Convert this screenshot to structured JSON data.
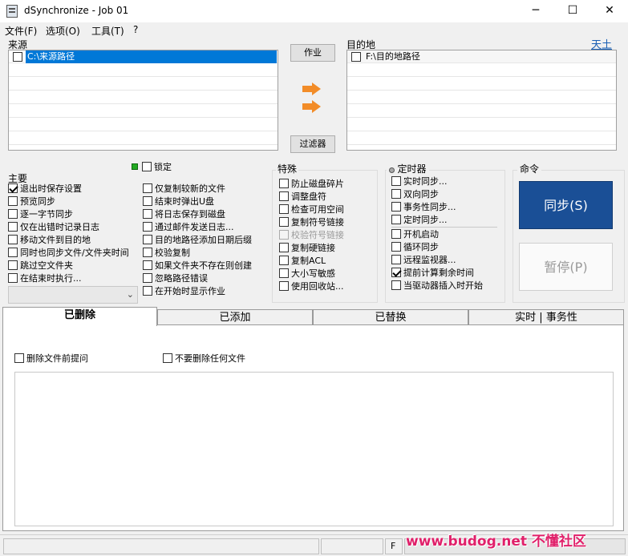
{
  "window": {
    "title": "dSynchronize - Job 01",
    "minimize": "─",
    "maximize": "☐",
    "close": "✕"
  },
  "menu": {
    "file": "文件(F)",
    "options": "选项(O)",
    "tools": "工具(T)",
    "help": "?"
  },
  "source": {
    "label": "来源",
    "path": "C:\\来源路径"
  },
  "dest": {
    "label": "目的地",
    "path": "F:\\目的地路径",
    "link": "天土"
  },
  "buttons": {
    "job": "作业",
    "filter": "过滤器"
  },
  "lock": {
    "label": "锁定"
  },
  "main": {
    "label": "主要",
    "col1": [
      {
        "label": "退出时保存设置",
        "checked": true
      },
      {
        "label": "预览同步",
        "checked": false
      },
      {
        "label": "逐一字节同步",
        "checked": false
      },
      {
        "label": "仅在出错时记录日志",
        "checked": false
      },
      {
        "label": "移动文件到目的地",
        "checked": false
      },
      {
        "label": "同时也同步文件/文件夹时间",
        "checked": false
      },
      {
        "label": "跳过空文件夹",
        "checked": false
      },
      {
        "label": "在结束时执行...",
        "checked": false
      }
    ],
    "col2": [
      {
        "label": "仅复制较新的文件",
        "checked": false
      },
      {
        "label": "结束时弹出U盘",
        "checked": false
      },
      {
        "label": "将日志保存到磁盘",
        "checked": false
      },
      {
        "label": "通过邮件发送日志...",
        "checked": false
      },
      {
        "label": "目的地路径添加日期后缀",
        "checked": false
      },
      {
        "label": "校验复制",
        "checked": false
      },
      {
        "label": "如果文件夹不存在则创建",
        "checked": false
      },
      {
        "label": "忽略路径错误",
        "checked": false
      },
      {
        "label": "在开始时显示作业",
        "checked": false
      }
    ]
  },
  "special": {
    "label": "特殊",
    "items": [
      {
        "label": "防止磁盘碎片",
        "checked": false,
        "disabled": false
      },
      {
        "label": "调整盘符",
        "checked": false,
        "disabled": false
      },
      {
        "label": "检查可用空间",
        "checked": false,
        "disabled": false
      },
      {
        "label": "复制符号链接",
        "checked": false,
        "disabled": false
      },
      {
        "label": "校验符号链接",
        "checked": false,
        "disabled": true
      },
      {
        "label": "复制硬链接",
        "checked": false,
        "disabled": false
      },
      {
        "label": "复制ACL",
        "checked": false,
        "disabled": false
      },
      {
        "label": "大小写敏感",
        "checked": false,
        "disabled": false
      },
      {
        "label": "使用回收站...",
        "checked": false,
        "disabled": false
      }
    ]
  },
  "timer": {
    "label": "定时器",
    "items_a": [
      {
        "label": "实时同步...",
        "checked": false
      },
      {
        "label": "双向同步",
        "checked": false
      },
      {
        "label": "事务性同步...",
        "checked": false
      },
      {
        "label": "定时同步...",
        "checked": false
      }
    ],
    "items_b": [
      {
        "label": "开机启动",
        "checked": false
      },
      {
        "label": "循环同步",
        "checked": false
      },
      {
        "label": "远程监视器...",
        "checked": false
      },
      {
        "label": "提前计算剩余时间",
        "checked": true
      },
      {
        "label": "当驱动器插入时开始",
        "checked": false
      }
    ]
  },
  "command": {
    "label": "命令",
    "sync": "同步(S)",
    "pause": "暂停(P)"
  },
  "tabs": [
    "已删除",
    "已添加",
    "已替换",
    "实时 | 事务性"
  ],
  "deleted_tab": {
    "confirm": "删除文件前提问",
    "never_delete": "不要删除任何文件"
  },
  "status": {
    "drive": "F"
  },
  "watermark": {
    "text": "www.budog.net 不懂社区"
  },
  "colors": {
    "accent": "#0078d7",
    "sync_button": "#1a4f96",
    "arrow": "#f28c28"
  }
}
